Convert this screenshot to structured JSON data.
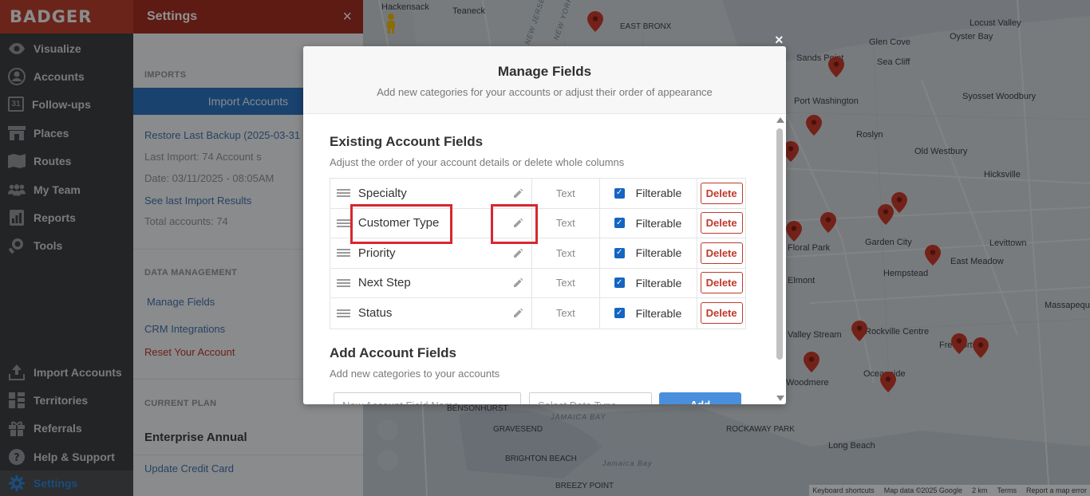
{
  "app": {
    "logo": "BADGER"
  },
  "nav": {
    "items": [
      {
        "label": "Visualize",
        "icon": "eye-icon"
      },
      {
        "label": "Accounts",
        "icon": "user-icon"
      },
      {
        "label": "Follow-ups",
        "icon": "calendar-icon",
        "icon_text": "31"
      },
      {
        "label": "Places",
        "icon": "store-icon"
      },
      {
        "label": "Routes",
        "icon": "map-icon"
      },
      {
        "label": "My Team",
        "icon": "team-icon"
      },
      {
        "label": "Reports",
        "icon": "report-icon"
      },
      {
        "label": "Tools",
        "icon": "tools-icon"
      }
    ],
    "bottom_items": [
      {
        "label": "Import Accounts",
        "icon": "upload-icon"
      },
      {
        "label": "Territories",
        "icon": "grid-icon"
      },
      {
        "label": "Referrals",
        "icon": "gift-icon"
      },
      {
        "label": "Help & Support",
        "icon": "help-icon"
      },
      {
        "label": "Settings",
        "icon": "gear-icon"
      }
    ],
    "active_color": "#2d7fcf"
  },
  "settings": {
    "title": "Settings",
    "close": "×",
    "imports_section": "IMPORTS",
    "import_button": "Import Accounts",
    "restore_link": "Restore Last Backup (2025-03-31",
    "last_import": "Last Import: 74 Account s",
    "date": "Date: 03/11/2025 - 08:05AM",
    "see_results": "See last Import Results",
    "total_accounts": "Total accounts: 74",
    "data_section": "DATA MANAGEMENT",
    "manage_fields": "Manage Fields",
    "crm": "CRM Integrations",
    "reset": "Reset Your Account",
    "plan_section": "CURRENT PLAN",
    "plan_name": "Enterprise Annual",
    "update_card": "Update Credit Card"
  },
  "modal": {
    "close": "×",
    "title": "Manage Fields",
    "subtitle": "Add new categories for your accounts or adjust their order of appearance",
    "existing_title": "Existing Account Fields",
    "existing_sub": "Adjust the order of your account details or delete whole columns",
    "fields": [
      {
        "name": "Specialty",
        "type": "Text",
        "filter_label": "Filterable",
        "delete_label": "Delete"
      },
      {
        "name": "Customer Type",
        "type": "Text",
        "filter_label": "Filterable",
        "delete_label": "Delete"
      },
      {
        "name": "Priority",
        "type": "Text",
        "filter_label": "Filterable",
        "delete_label": "Delete"
      },
      {
        "name": "Next Step",
        "type": "Text",
        "filter_label": "Filterable",
        "delete_label": "Delete"
      },
      {
        "name": "Status",
        "type": "Text",
        "filter_label": "Filterable",
        "delete_label": "Delete"
      }
    ],
    "add_title": "Add Account Fields",
    "add_sub": "Add new categories to your accounts",
    "new_field_placeholder": "New Account Field Name",
    "type_placeholder": "Select Data Type",
    "add_button": "Add"
  },
  "map": {
    "labels": [
      "Hackensack",
      "Teaneck",
      "EAST BRONX",
      "Glen Cove",
      "Locust Valley",
      "Oyster Bay",
      "Sea Cliff",
      "Sands Point",
      "Port Washington",
      "Syosset Woodbury",
      "Roslyn",
      "Old Westbury",
      "Hicksville",
      "Garden City",
      "Levittown",
      "East Meadow",
      "Floral Park",
      "Hempstead",
      "Elmont",
      "Massapequa",
      "Valley Stream",
      "Rockville Centre",
      "Freeport",
      "Oceanside",
      "Woodmere",
      "BENSONHURST",
      "GRAVESEND",
      "ROCKAWAY PARK",
      "Long Beach",
      "BRIGHTON BEACH",
      "JAMAICA BAY",
      "BREEZY POINT",
      "Jamaica Bay",
      "NEW JERSEY",
      "NEW YORK"
    ],
    "footer": [
      "Keyboard shortcuts",
      "Map data ©2025 Google",
      "2 km",
      "Terms",
      "Report a map error"
    ],
    "pin_color": "#c0392b"
  }
}
